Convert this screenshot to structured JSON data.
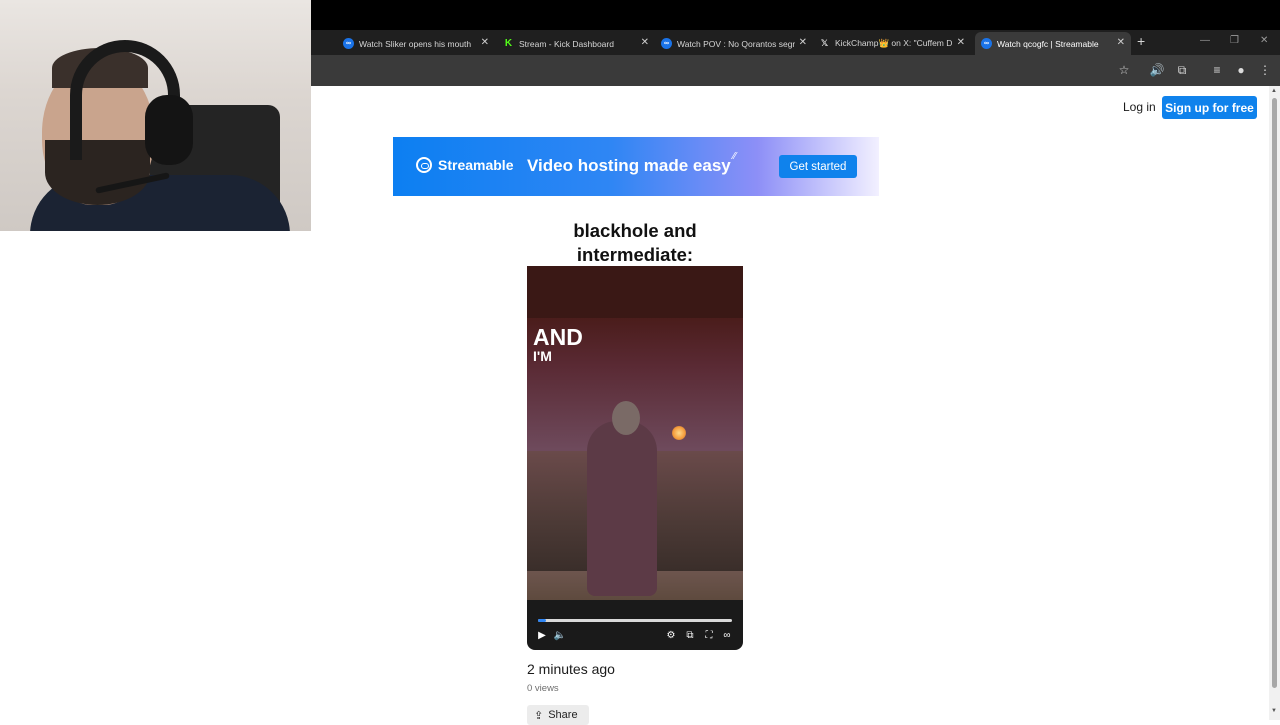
{
  "browser": {
    "tabs": [
      {
        "title": "Watch Sliker opens his mouth",
        "favicon": "streamable-icon",
        "active": false
      },
      {
        "title": "Stream - Kick Dashboard",
        "favicon": "kick-icon",
        "active": false
      },
      {
        "title": "Watch POV : No Qorantos segr",
        "favicon": "streamable-icon",
        "active": false
      },
      {
        "title": "KickChamp👑 on X: \"Cuffem D",
        "favicon": "x-icon",
        "active": false
      },
      {
        "title": "Watch qcogfc | Streamable",
        "favicon": "streamable-icon",
        "active": true
      }
    ],
    "close_glyph": "✕",
    "new_tab_glyph": "+",
    "kick_glyph": "K",
    "x_glyph": "𝕏",
    "streamable_glyph": "∞",
    "window_controls": {
      "minimize": "—",
      "maximize": "❐",
      "close": "✕"
    },
    "toolbar_icons": {
      "star": "☆",
      "audio": "🔊",
      "extensions": "⧉",
      "media": "≡",
      "profile": "●",
      "menu": "⋮"
    }
  },
  "header": {
    "login_label": "Log in",
    "signup_label": "Sign up for free"
  },
  "banner": {
    "logo_text": "Streamable",
    "tagline": "Video hosting made easy",
    "cta_label": "Get started"
  },
  "video": {
    "caption_line1": "blackhole and",
    "caption_line2": "intermediate:",
    "overlay_text_1": "AND",
    "overlay_text_2": "I'M",
    "progress_fraction": 0.04,
    "controls": {
      "play": "▶",
      "volume": "🔈",
      "settings": "⚙",
      "pip": "⧉",
      "fullscreen": "⛶",
      "logo": "∞"
    }
  },
  "meta": {
    "timestamp": "2 minutes ago",
    "views": "0 views",
    "share_label": "Share",
    "share_icon": "⇪"
  },
  "colors": {
    "accent": "#0f82ec",
    "tab_strip": "#1f1f1f",
    "toolbar": "#3a3a3a"
  }
}
